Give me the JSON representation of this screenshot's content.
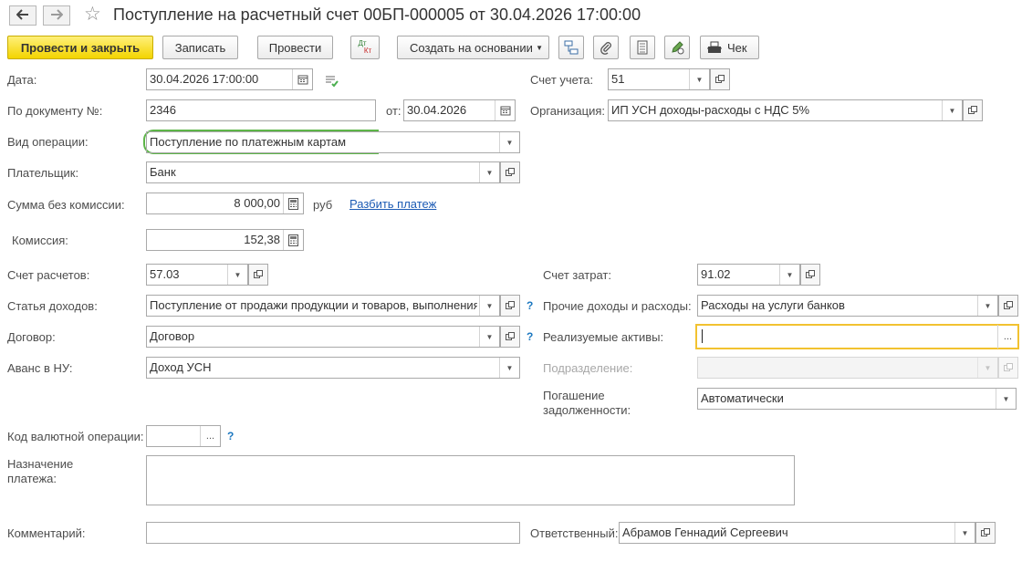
{
  "window": {
    "title": "Поступление на расчетный счет 00БП-000005 от 30.04.2026 17:00:00"
  },
  "toolbar": {
    "post_close_label": "Провести и закрыть",
    "save_label": "Записать",
    "post_label": "Провести",
    "dtkt_top": "Дт",
    "dtkt_bottom": "Кт",
    "create_based_label": "Создать на основании",
    "receipt_label": "Чек"
  },
  "form": {
    "date": {
      "label": "Дата:",
      "value": "30.04.2026 17:00:00"
    },
    "doc_number": {
      "label": "По документу №:",
      "value": "2346"
    },
    "doc_date": {
      "label": "от:",
      "value": "30.04.2026"
    },
    "operation_type": {
      "label": "Вид операции:",
      "value": "Поступление по платежным картам"
    },
    "payer": {
      "label": "Плательщик:",
      "value": "Банк"
    },
    "amount": {
      "label": "Сумма без комиссии:",
      "value": "8 000,00",
      "currency": "руб"
    },
    "split_payment_link": "Разбить платеж",
    "commission": {
      "label": "Комиссия:",
      "value": "152,38"
    },
    "settlement_account": {
      "label": "Счет расчетов:",
      "value": "57.03"
    },
    "income_item": {
      "label": "Статья доходов:",
      "value": "Поступление от продажи продукции и товаров, выполнения"
    },
    "contract": {
      "label": "Договор:",
      "value": "Договор"
    },
    "advance_nu": {
      "label": "Аванс в НУ:",
      "value": "Доход УСН"
    },
    "currency_operation_code": {
      "label": "Код валютной операции:",
      "value": ""
    },
    "payment_purpose": {
      "label_line1": "Назначение",
      "label_line2": "платежа:",
      "value": ""
    },
    "comment": {
      "label": "Комментарий:",
      "value": ""
    },
    "account": {
      "label": "Счет учета:",
      "value": "51"
    },
    "organization": {
      "label": "Организация:",
      "value": "ИП УСН доходы-расходы с НДС 5%"
    },
    "cost_account": {
      "label": "Счет затрат:",
      "value": "91.02"
    },
    "other_income_expense": {
      "label": "Прочие доходы и расходы:",
      "value": "Расходы на услуги банков"
    },
    "sold_assets": {
      "label": "Реализуемые активы:",
      "value": ""
    },
    "department": {
      "label": "Подразделение:",
      "value": ""
    },
    "debt_repayment": {
      "label_line1": "Погашение",
      "label_line2": "задолженности:",
      "value": "Автоматически"
    },
    "responsible": {
      "label": "Ответственный:",
      "value": "Абрамов Геннадий Сергеевич"
    },
    "help_mark": "?",
    "ellipsis": "..."
  },
  "icons": {
    "back": "arrow-left-icon",
    "forward": "arrow-right-icon",
    "favorite": "star-icon",
    "calendar": "calendar-icon",
    "dropdown": "triangle-down-icon",
    "open": "open-form-icon",
    "structure": "structure-icon",
    "attachment": "paperclip-icon",
    "document": "document-icon",
    "edit": "edit-pencil-icon",
    "print_receipt": "cash-register-icon"
  },
  "colors": {
    "primary_button": "#f3d400",
    "focus_green": "#5db548",
    "focus_yellow": "#f2c230",
    "link": "#1c5bb4",
    "help": "#1c78c0"
  }
}
